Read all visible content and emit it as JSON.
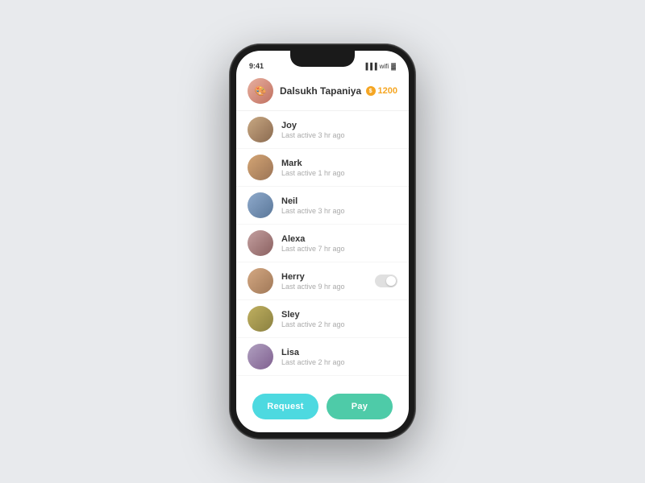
{
  "header": {
    "user_name": "Dalsukh Tapaniya",
    "coin_amount": "1200",
    "coin_icon": "🪙"
  },
  "contacts": [
    {
      "id": 1,
      "name": "Joy",
      "status": "Last active 3 hr ago",
      "has_toggle": false,
      "avatar_emoji": "👤"
    },
    {
      "id": 2,
      "name": "Mark",
      "status": "Last active 1 hr ago",
      "has_toggle": false,
      "avatar_emoji": "👤"
    },
    {
      "id": 3,
      "name": "Neil",
      "status": "Last active 3 hr ago",
      "has_toggle": false,
      "avatar_emoji": "👤"
    },
    {
      "id": 4,
      "name": "Alexa",
      "status": "Last active 7 hr ago",
      "has_toggle": false,
      "avatar_emoji": "👤"
    },
    {
      "id": 5,
      "name": "Herry",
      "status": "Last active 9 hr ago",
      "has_toggle": true,
      "avatar_emoji": "👤"
    },
    {
      "id": 6,
      "name": "Sley",
      "status": "Last active 2 hr ago",
      "has_toggle": false,
      "avatar_emoji": "👤"
    },
    {
      "id": 7,
      "name": "Lisa",
      "status": "Last active 2 hr ago",
      "has_toggle": false,
      "avatar_emoji": "👤"
    }
  ],
  "avatar_classes": [
    "av-joy",
    "av-mark",
    "av-neil",
    "av-alexa",
    "av-herry",
    "av-sley",
    "av-lisa"
  ],
  "buttons": {
    "request_label": "Request",
    "pay_label": "Pay"
  }
}
